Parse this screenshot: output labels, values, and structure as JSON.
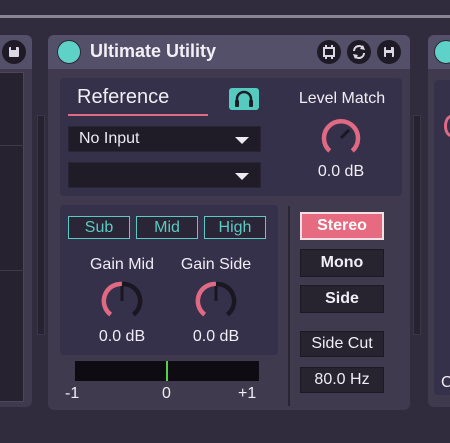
{
  "device": {
    "title": "Ultimate Utility"
  },
  "reference": {
    "label": "Reference",
    "input_selected": "No Input",
    "channel_selected": ""
  },
  "level_match": {
    "label": "Level Match",
    "value": "0.0 dB"
  },
  "bands": [
    "Sub",
    "Mid",
    "High"
  ],
  "gain_mid": {
    "label": "Gain Mid",
    "value": "0.0 dB"
  },
  "gain_side": {
    "label": "Gain Side",
    "value": "0.0 dB"
  },
  "modes": {
    "stereo": "Stereo",
    "mono": "Mono",
    "side": "Side",
    "active": "Stereo"
  },
  "side_cut": {
    "label": "Side Cut",
    "value": "80.0 Hz"
  },
  "meter": {
    "left": "-1",
    "center": "0",
    "right": "+1",
    "correlation": 0
  },
  "right_device": {
    "partial_letter": "C"
  },
  "colors": {
    "accent_teal": "#5fd2c8",
    "accent_pink": "#e76b80",
    "meter_green": "#54d146"
  }
}
